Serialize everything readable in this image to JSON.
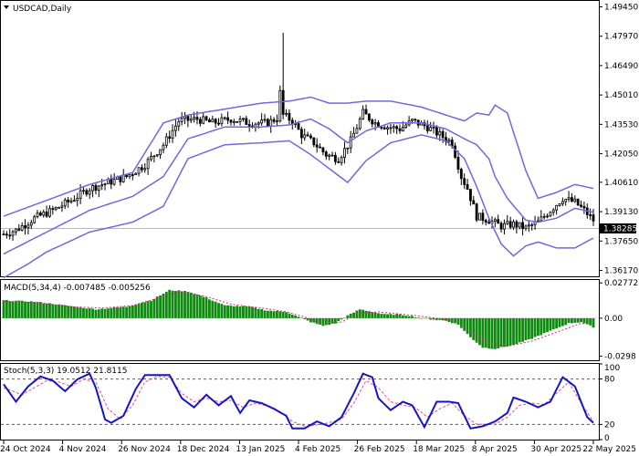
{
  "chart_data": {
    "type": "candlestick",
    "symbol_label": "USDCAD,Daily",
    "price_axis": {
      "ticks": [
        "1.49450",
        "1.47970",
        "1.46490",
        "1.45010",
        "1.43530",
        "1.42050",
        "1.40610",
        "1.39130",
        "1.37650",
        "1.36170"
      ],
      "ylim": [
        1.3587,
        1.4975
      ],
      "current_price": 1.38285,
      "current_price_label": "1.38285"
    },
    "x_axis": {
      "ticks": [
        "24 Oct 2024",
        "4 Nov 2024",
        "26 Nov 2024",
        "18 Dec 2024",
        "13 Jan 2025",
        "4 Feb 2025",
        "26 Feb 2025",
        "18 Mar 2025",
        "8 Apr 2025",
        "30 Apr 2025",
        "22 May 2025"
      ]
    },
    "price_keypoints": [
      [
        0,
        1.38
      ],
      [
        4,
        1.382
      ],
      [
        10,
        1.388
      ],
      [
        16,
        1.392
      ],
      [
        22,
        1.397
      ],
      [
        28,
        1.403
      ],
      [
        34,
        1.406
      ],
      [
        40,
        1.409
      ],
      [
        46,
        1.415
      ],
      [
        52,
        1.425
      ],
      [
        57,
        1.437
      ],
      [
        63,
        1.438
      ],
      [
        68,
        1.436
      ],
      [
        74,
        1.438
      ],
      [
        80,
        1.436
      ],
      [
        86,
        1.436
      ],
      [
        91,
        1.44
      ],
      [
        94,
        1.437
      ],
      [
        97,
        1.43
      ],
      [
        101,
        1.426
      ],
      [
        105,
        1.42
      ],
      [
        109,
        1.418
      ],
      [
        113,
        1.427
      ],
      [
        117,
        1.441
      ],
      [
        121,
        1.436
      ],
      [
        125,
        1.434
      ],
      [
        129,
        1.433
      ],
      [
        133,
        1.437
      ],
      [
        138,
        1.434
      ],
      [
        141,
        1.431
      ],
      [
        146,
        1.426
      ],
      [
        149,
        1.409
      ],
      [
        151,
        1.403
      ],
      [
        154,
        1.389
      ],
      [
        158,
        1.387
      ],
      [
        162,
        1.384
      ],
      [
        166,
        1.385
      ],
      [
        170,
        1.383
      ],
      [
        174,
        1.386
      ],
      [
        178,
        1.392
      ],
      [
        182,
        1.398
      ],
      [
        186,
        1.396
      ],
      [
        189,
        1.392
      ],
      [
        192,
        1.387
      ]
    ],
    "bollinger": {
      "upper_keypoints": [
        [
          0,
          1.389
        ],
        [
          14,
          1.397
        ],
        [
          28,
          1.405
        ],
        [
          42,
          1.411
        ],
        [
          52,
          1.436
        ],
        [
          60,
          1.44
        ],
        [
          72,
          1.443
        ],
        [
          84,
          1.446
        ],
        [
          93,
          1.447
        ],
        [
          100,
          1.449
        ],
        [
          106,
          1.446
        ],
        [
          112,
          1.446
        ],
        [
          118,
          1.447
        ],
        [
          126,
          1.447
        ],
        [
          136,
          1.444
        ],
        [
          144,
          1.44
        ],
        [
          150,
          1.437
        ],
        [
          154,
          1.441
        ],
        [
          158,
          1.44
        ],
        [
          160,
          1.445
        ],
        [
          164,
          1.441
        ],
        [
          170,
          1.412
        ],
        [
          174,
          1.398
        ],
        [
          180,
          1.401
        ],
        [
          186,
          1.405
        ],
        [
          192,
          1.403
        ]
      ],
      "middle_keypoints": [
        [
          0,
          1.37
        ],
        [
          14,
          1.381
        ],
        [
          28,
          1.392
        ],
        [
          42,
          1.399
        ],
        [
          52,
          1.409
        ],
        [
          60,
          1.428
        ],
        [
          72,
          1.434
        ],
        [
          84,
          1.434
        ],
        [
          93,
          1.435
        ],
        [
          100,
          1.438
        ],
        [
          106,
          1.433
        ],
        [
          112,
          1.426
        ],
        [
          118,
          1.432
        ],
        [
          126,
          1.436
        ],
        [
          136,
          1.436
        ],
        [
          144,
          1.433
        ],
        [
          150,
          1.428
        ],
        [
          154,
          1.425
        ],
        [
          158,
          1.418
        ],
        [
          160,
          1.409
        ],
        [
          164,
          1.398
        ],
        [
          170,
          1.387
        ],
        [
          174,
          1.386
        ],
        [
          180,
          1.388
        ],
        [
          186,
          1.393
        ],
        [
          192,
          1.391
        ]
      ],
      "lower_keypoints": [
        [
          0,
          1.358
        ],
        [
          8,
          1.365
        ],
        [
          14,
          1.371
        ],
        [
          28,
          1.381
        ],
        [
          42,
          1.386
        ],
        [
          52,
          1.394
        ],
        [
          60,
          1.418
        ],
        [
          72,
          1.425
        ],
        [
          84,
          1.426
        ],
        [
          93,
          1.427
        ],
        [
          100,
          1.42
        ],
        [
          106,
          1.413
        ],
        [
          112,
          1.406
        ],
        [
          118,
          1.417
        ],
        [
          126,
          1.426
        ],
        [
          136,
          1.43
        ],
        [
          144,
          1.427
        ],
        [
          150,
          1.418
        ],
        [
          154,
          1.404
        ],
        [
          158,
          1.388
        ],
        [
          162,
          1.375
        ],
        [
          166,
          1.369
        ],
        [
          170,
          1.374
        ],
        [
          174,
          1.376
        ],
        [
          180,
          1.373
        ],
        [
          186,
          1.373
        ],
        [
          192,
          1.378
        ]
      ]
    },
    "macd": {
      "label": "MACD(5,34,4) -0.007485 -0.005256",
      "ticks": [
        "0.02772",
        "0.00",
        "-0.0298"
      ],
      "ylim": [
        -0.033,
        0.03
      ],
      "hist_keypoints": [
        [
          0,
          0.014
        ],
        [
          10,
          0.013
        ],
        [
          20,
          0.01
        ],
        [
          30,
          0.007
        ],
        [
          40,
          0.009
        ],
        [
          48,
          0.014
        ],
        [
          54,
          0.022
        ],
        [
          60,
          0.021
        ],
        [
          66,
          0.016
        ],
        [
          72,
          0.01
        ],
        [
          80,
          0.009
        ],
        [
          86,
          0.006
        ],
        [
          92,
          0.005
        ],
        [
          96,
          0.001
        ],
        [
          100,
          -0.003
        ],
        [
          104,
          -0.006
        ],
        [
          108,
          -0.004
        ],
        [
          112,
          0.002
        ],
        [
          116,
          0.007
        ],
        [
          120,
          0.005
        ],
        [
          124,
          0.003
        ],
        [
          128,
          0.003
        ],
        [
          132,
          0.002
        ],
        [
          136,
          0.0
        ],
        [
          140,
          -0.001
        ],
        [
          144,
          -0.002
        ],
        [
          148,
          -0.005
        ],
        [
          152,
          -0.015
        ],
        [
          156,
          -0.023
        ],
        [
          160,
          -0.024
        ],
        [
          166,
          -0.021
        ],
        [
          172,
          -0.016
        ],
        [
          178,
          -0.01
        ],
        [
          184,
          -0.004
        ],
        [
          188,
          -0.003
        ],
        [
          192,
          -0.007
        ]
      ],
      "signal_keypoints": [
        [
          0,
          0.013
        ],
        [
          12,
          0.012
        ],
        [
          22,
          0.009
        ],
        [
          32,
          0.008
        ],
        [
          42,
          0.01
        ],
        [
          52,
          0.017
        ],
        [
          58,
          0.021
        ],
        [
          66,
          0.017
        ],
        [
          74,
          0.011
        ],
        [
          84,
          0.008
        ],
        [
          92,
          0.005
        ],
        [
          98,
          0.001
        ],
        [
          104,
          -0.005
        ],
        [
          110,
          -0.003
        ],
        [
          116,
          0.004
        ],
        [
          122,
          0.005
        ],
        [
          130,
          0.003
        ],
        [
          138,
          0.001
        ],
        [
          146,
          -0.002
        ],
        [
          152,
          -0.011
        ],
        [
          158,
          -0.02
        ],
        [
          164,
          -0.022
        ],
        [
          172,
          -0.018
        ],
        [
          180,
          -0.011
        ],
        [
          188,
          -0.004
        ],
        [
          192,
          -0.005
        ]
      ]
    },
    "stochastic": {
      "label": "Stoch(5,3,3) 19.0512 21.8115",
      "ticks": [
        "100",
        "80",
        "20",
        "0"
      ],
      "ylim": [
        0,
        100
      ],
      "levels": [
        80,
        20
      ],
      "k_keypoints": [
        [
          0,
          75
        ],
        [
          4,
          50
        ],
        [
          8,
          72
        ],
        [
          12,
          86
        ],
        [
          16,
          80
        ],
        [
          20,
          65
        ],
        [
          24,
          82
        ],
        [
          28,
          90
        ],
        [
          30,
          70
        ],
        [
          33,
          25
        ],
        [
          35,
          20
        ],
        [
          39,
          30
        ],
        [
          43,
          68
        ],
        [
          46,
          88
        ],
        [
          50,
          88
        ],
        [
          54,
          88
        ],
        [
          58,
          55
        ],
        [
          62,
          42
        ],
        [
          66,
          60
        ],
        [
          70,
          45
        ],
        [
          74,
          58
        ],
        [
          77,
          34
        ],
        [
          80,
          52
        ],
        [
          84,
          48
        ],
        [
          88,
          40
        ],
        [
          92,
          30
        ],
        [
          94,
          12
        ],
        [
          98,
          12
        ],
        [
          102,
          22
        ],
        [
          106,
          15
        ],
        [
          110,
          28
        ],
        [
          114,
          62
        ],
        [
          117,
          90
        ],
        [
          120,
          85
        ],
        [
          122,
          55
        ],
        [
          126,
          38
        ],
        [
          130,
          50
        ],
        [
          133,
          45
        ],
        [
          137,
          14
        ],
        [
          141,
          50
        ],
        [
          145,
          50
        ],
        [
          148,
          48
        ],
        [
          152,
          12
        ],
        [
          156,
          15
        ],
        [
          160,
          22
        ],
        [
          164,
          34
        ],
        [
          166,
          56
        ],
        [
          170,
          50
        ],
        [
          174,
          42
        ],
        [
          178,
          50
        ],
        [
          182,
          85
        ],
        [
          186,
          72
        ],
        [
          190,
          28
        ],
        [
          192,
          20
        ]
      ],
      "d_keypoints": [
        [
          0,
          70
        ],
        [
          6,
          60
        ],
        [
          10,
          70
        ],
        [
          14,
          80
        ],
        [
          18,
          78
        ],
        [
          22,
          72
        ],
        [
          26,
          82
        ],
        [
          30,
          78
        ],
        [
          34,
          40
        ],
        [
          38,
          25
        ],
        [
          42,
          45
        ],
        [
          46,
          78
        ],
        [
          50,
          86
        ],
        [
          54,
          85
        ],
        [
          58,
          62
        ],
        [
          62,
          50
        ],
        [
          66,
          55
        ],
        [
          70,
          50
        ],
        [
          74,
          52
        ],
        [
          78,
          42
        ],
        [
          82,
          48
        ],
        [
          86,
          44
        ],
        [
          90,
          36
        ],
        [
          94,
          22
        ],
        [
          98,
          15
        ],
        [
          104,
          18
        ],
        [
          110,
          25
        ],
        [
          114,
          48
        ],
        [
          118,
          80
        ],
        [
          122,
          70
        ],
        [
          126,
          50
        ],
        [
          130,
          45
        ],
        [
          134,
          42
        ],
        [
          138,
          28
        ],
        [
          142,
          40
        ],
        [
          146,
          48
        ],
        [
          150,
          30
        ],
        [
          154,
          18
        ],
        [
          160,
          18
        ],
        [
          164,
          28
        ],
        [
          168,
          45
        ],
        [
          172,
          48
        ],
        [
          176,
          46
        ],
        [
          180,
          62
        ],
        [
          184,
          78
        ],
        [
          188,
          48
        ],
        [
          192,
          22
        ]
      ]
    },
    "colors": {
      "bollinger": "#6b6bdc",
      "stoch_k": "#1515c8",
      "stoch_d": "#e0508a",
      "macd_hist": "#0f8c0f",
      "macd_signal": "#d02a7a",
      "level_line": "#cc2a2a",
      "current_price_line": "#b8b8b8",
      "candle": "#000000"
    }
  }
}
